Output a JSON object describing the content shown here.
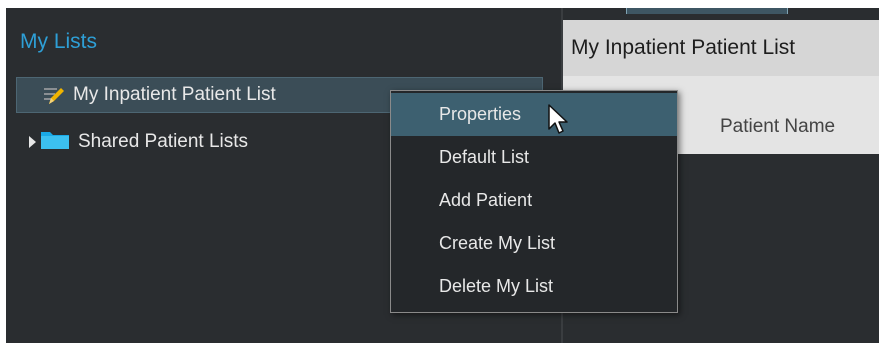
{
  "left_panel": {
    "title": "My Lists",
    "items": [
      {
        "label": "My Inpatient Patient List",
        "icon": "pencil-icon",
        "selected": true
      },
      {
        "label": "Shared Patient Lists",
        "icon": "folder-icon",
        "expander": "arrow-right-icon"
      }
    ]
  },
  "right_panel": {
    "header": "My Inpatient Patient List",
    "column_label": "Patient Name"
  },
  "context_menu": {
    "items": [
      {
        "label": "Properties",
        "hovered": true
      },
      {
        "label": "Default List"
      },
      {
        "label": "Add Patient"
      },
      {
        "label": "Create My List"
      },
      {
        "label": "Delete My List"
      }
    ]
  },
  "colors": {
    "accent": "#2e9fd6",
    "panel_bg": "#2a2d30",
    "selected_bg": "#3b4d57",
    "menu_hover": "#3d6070"
  }
}
